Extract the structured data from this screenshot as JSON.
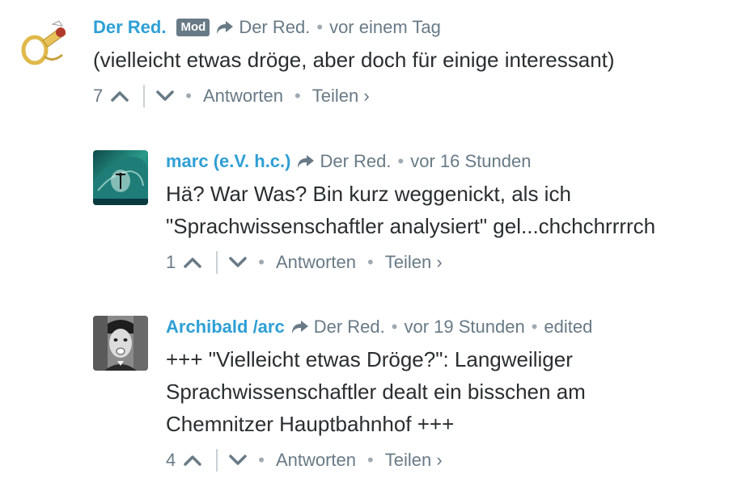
{
  "comments": [
    {
      "author": "Der Red.",
      "badge": "Mod",
      "reply_to": "Der Red.",
      "time": "vor einem Tag",
      "edited": "",
      "text": "(vielleicht etwas dröge, aber doch für einige interessant)",
      "votes": "7",
      "reply_label": "Antworten",
      "share_label": "Teilen ›",
      "avatar_icon": "post-horn-icon"
    },
    {
      "author": "marc (e.V. h.c.)",
      "badge": "",
      "reply_to": "Der Red.",
      "time": "vor 16 Stunden",
      "edited": "",
      "text": "Hä? War Was? Bin kurz weggenickt, als ich \"Sprachwissenschaftler analysiert\" gel...chchchrrrrch",
      "votes": "1",
      "reply_label": "Antworten",
      "share_label": "Teilen ›",
      "avatar_icon": "wave-surfer-icon"
    },
    {
      "author": "Archibald /arc",
      "badge": "",
      "reply_to": "Der Red.",
      "time": "vor 19 Stunden",
      "edited": "edited",
      "text": "+++ \"Vielleicht etwas Dröge?\": Langweiliger Sprachwissenschaftler dealt ein bisschen am Chemnitzer Hauptbahnhof +++",
      "votes": "4",
      "reply_label": "Antworten",
      "share_label": "Teilen ›",
      "avatar_icon": "bw-portrait-icon"
    }
  ],
  "colors": {
    "author": "#2e9fd5",
    "meta": "#687a86",
    "text": "#2a2e2e",
    "badge_bg": "#687a86"
  }
}
